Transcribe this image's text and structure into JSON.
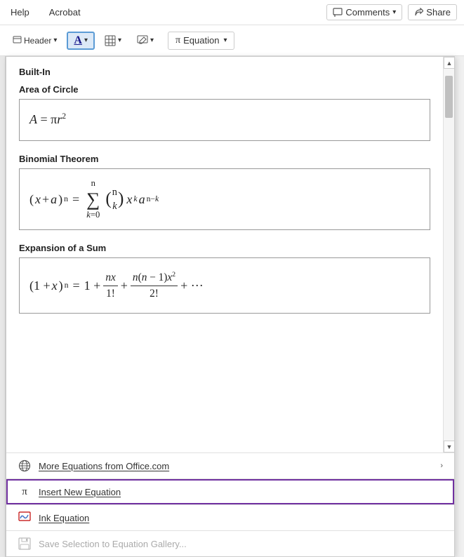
{
  "menubar": {
    "items": [
      {
        "label": "Help"
      },
      {
        "label": "Acrobat"
      }
    ],
    "comments_label": "Comments",
    "share_label": "Share"
  },
  "ribbon": {
    "header_label": "Header",
    "text_btn_label": "A",
    "table_btn_label": "⊞",
    "edit_btn_label": "✎",
    "equation_label": "Equation"
  },
  "panel": {
    "section_title": "Built-In",
    "equations": [
      {
        "label": "Area of Circle",
        "formula_html": "<span class='math'><i>A</i> = π<i>r</i><sup>2</sup></span>"
      },
      {
        "label": "Binomial Theorem",
        "formula_html": ""
      },
      {
        "label": "Expansion of a Sum",
        "formula_html": ""
      }
    ],
    "bottom_items": [
      {
        "icon": "🌐",
        "label": "More Equations from Office.com",
        "has_chevron": true,
        "disabled": false,
        "selected": false,
        "underline_char": "M"
      },
      {
        "icon": "π",
        "label": "Insert New Equation",
        "has_chevron": false,
        "disabled": false,
        "selected": true,
        "underline_char": "I"
      },
      {
        "icon": "✏",
        "label": "Ink Equation",
        "has_chevron": false,
        "disabled": false,
        "selected": false,
        "underline_char": "k"
      },
      {
        "icon": "💾",
        "label": "Save Selection to Equation Gallery...",
        "has_chevron": false,
        "disabled": true,
        "selected": false,
        "underline_char": ""
      }
    ]
  }
}
